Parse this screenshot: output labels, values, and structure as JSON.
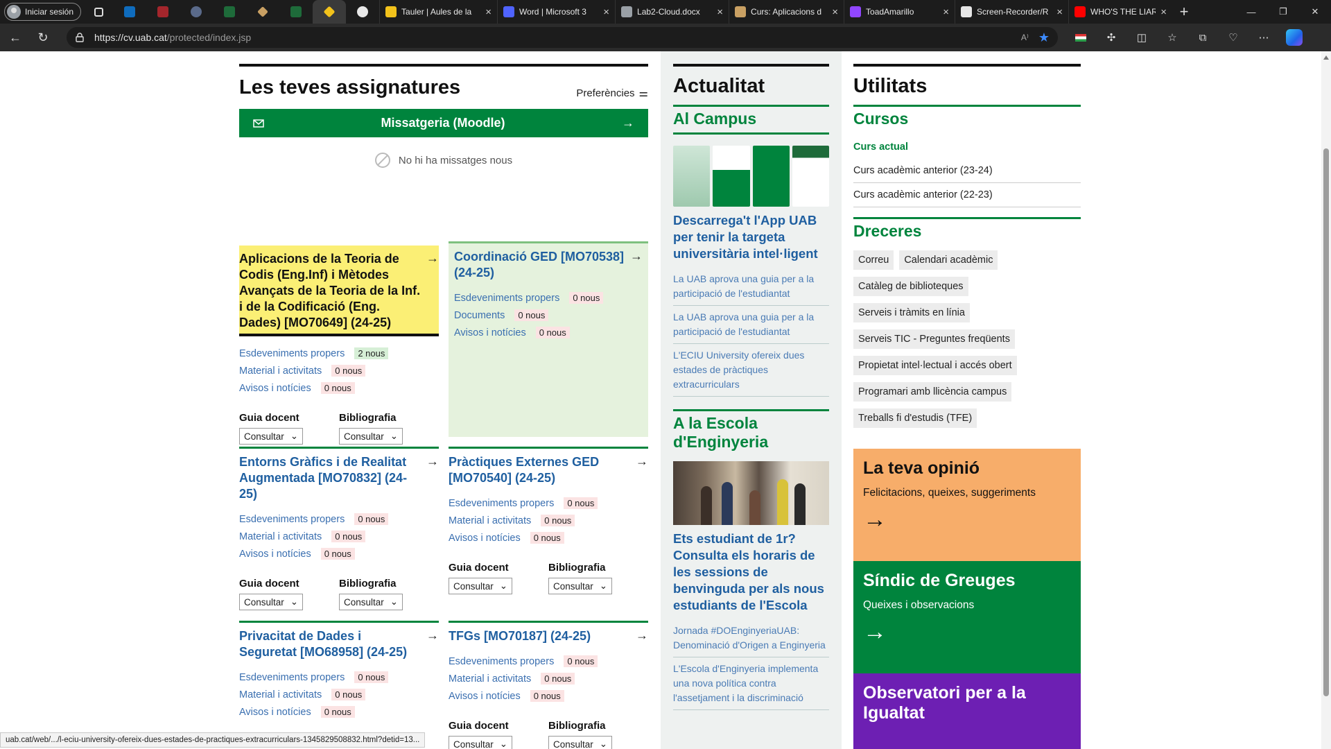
{
  "browser": {
    "profile_label": "Iniciar sesión",
    "tabs": [
      {
        "title": "Tauler | Aules de la",
        "color": "#f2c21b"
      },
      {
        "title": "Word | Microsoft 3",
        "color": "#4f63ff"
      },
      {
        "title": "Lab2-Cloud.docx",
        "color": "#9aa0a6"
      },
      {
        "title": "Curs: Aplicacions d",
        "color": "#c9a063"
      },
      {
        "title": "ToadAmarillo",
        "color": "#9146ff"
      },
      {
        "title": "Screen-Recorder/R",
        "color": "#e6e6e6"
      },
      {
        "title": "WHO'S THE LIAR |",
        "color": "#ff0000"
      }
    ],
    "url_host": "https://cv.uab.cat",
    "url_path": "/protected/index.jsp",
    "status_url": "uab.cat/web/.../l-eciu-university-ofereix-dues-estades-de-practiques-extracurriculars-1345829508832.html?detid=13..."
  },
  "assignatures": {
    "title": "Les teves assignatures",
    "prefs_label": "Preferències",
    "messaging_label": "Missatgeria (Moodle)",
    "no_messages": "No hi ha missatges nous",
    "courses": [
      {
        "name": "Aplicacions de la Teoria de Codis (Eng.Inf) i Mètodes Avançats de la Teoria de la Inf. i de la Codificació (Eng. Dades) [MO70649] (24-25)",
        "rows": [
          {
            "label": "Esdeveniments propers",
            "badge": "2 nous"
          },
          {
            "label": "Material i activitats",
            "badge": "0 nous"
          },
          {
            "label": "Avisos i notícies",
            "badge": "0 nous"
          }
        ],
        "guia": "Guia docent",
        "biblio": "Bibliografia",
        "consult": "Consultar"
      },
      {
        "name": "Coordinació GED [MO70538] (24-25)",
        "rows": [
          {
            "label": "Esdeveniments propers",
            "badge": "0 nous"
          },
          {
            "label": "Documents",
            "badge": "0 nous"
          },
          {
            "label": "Avisos i notícies",
            "badge": "0 nous"
          }
        ]
      },
      {
        "name": "Entorns Gràfics i de Realitat Augmentada [MO70832] (24-25)",
        "rows": [
          {
            "label": "Esdeveniments propers",
            "badge": "0 nous"
          },
          {
            "label": "Material i activitats",
            "badge": "0 nous"
          },
          {
            "label": "Avisos i notícies",
            "badge": "0 nous"
          }
        ],
        "guia": "Guia docent",
        "biblio": "Bibliografia",
        "consult": "Consultar"
      },
      {
        "name": "Pràctiques Externes GED [MO70540] (24-25)",
        "rows": [
          {
            "label": "Esdeveniments propers",
            "badge": "0 nous"
          },
          {
            "label": "Material i activitats",
            "badge": "0 nous"
          },
          {
            "label": "Avisos i notícies",
            "badge": "0 nous"
          }
        ],
        "guia": "Guia docent",
        "biblio": "Bibliografia",
        "consult": "Consultar"
      },
      {
        "name": "Privacitat de Dades i Seguretat [MO68958] (24-25)",
        "rows": [
          {
            "label": "Esdeveniments propers",
            "badge": "0 nous"
          },
          {
            "label": "Material i activitats",
            "badge": "0 nous"
          },
          {
            "label": "Avisos i notícies",
            "badge": "0 nous"
          }
        ],
        "guia": "Guia docent",
        "biblio": "Bibliografia",
        "consult": "Consultar"
      },
      {
        "name": "TFGs [MO70187] (24-25)",
        "rows": [
          {
            "label": "Esdeveniments propers",
            "badge": "0 nous"
          },
          {
            "label": "Material i activitats",
            "badge": "0 nous"
          },
          {
            "label": "Avisos i notícies",
            "badge": "0 nous"
          }
        ],
        "guia": "Guia docent",
        "biblio": "Bibliografia",
        "consult": "Consultar"
      }
    ]
  },
  "actualitat": {
    "title": "Actualitat",
    "campus_title": "Al Campus",
    "campus_main": "Descarrega't l'App UAB per tenir la targeta universitària intel·ligent",
    "campus_news": [
      "La UAB aprova una guia per a la participació de l'estudiantat",
      "La UAB aprova una guia per a la participació de l'estudiantat",
      "L'ECIU University ofereix dues estades de pràctiques extracurriculars"
    ],
    "escola_title": "A la Escola d'Enginyeria",
    "escola_main": "Ets estudiant de 1r? Consulta els horaris de les sessions de benvinguda per als nous estudiants de l'Escola",
    "escola_news": [
      "Jornada #DOEnginyeriaUAB: Denominació d'Origen a Enginyeria",
      "L'Escola d'Enginyeria implementa una nova política contra l'assetjament i la discriminació"
    ]
  },
  "utilitats": {
    "title": "Utilitats",
    "cursos_title": "Cursos",
    "cursos": [
      "Curs actual",
      "Curs acadèmic anterior (23-24)",
      "Curs acadèmic anterior (22-23)"
    ],
    "dreceres_title": "Dreceres",
    "dreceres": [
      "Correu",
      "Calendari acadèmic",
      "Catàleg de biblioteques",
      "Serveis i tràmits en línia",
      "Serveis TIC - Preguntes freqüents",
      "Propietat intel·lectual i accés obert",
      "Programari amb llicència campus",
      "Treballs fi d'estudis (TFE)"
    ],
    "promos": [
      {
        "title": "La teva opinió",
        "sub": "Felicitacions, queixes, suggeriments",
        "bg": "#f7ad6a"
      },
      {
        "title": "Síndic de Greuges",
        "sub": "Queixes i observacions",
        "bg": "#00843d"
      },
      {
        "title": "Observatori per a la Igualtat",
        "sub": "",
        "bg": "#6d1fb3"
      }
    ]
  }
}
